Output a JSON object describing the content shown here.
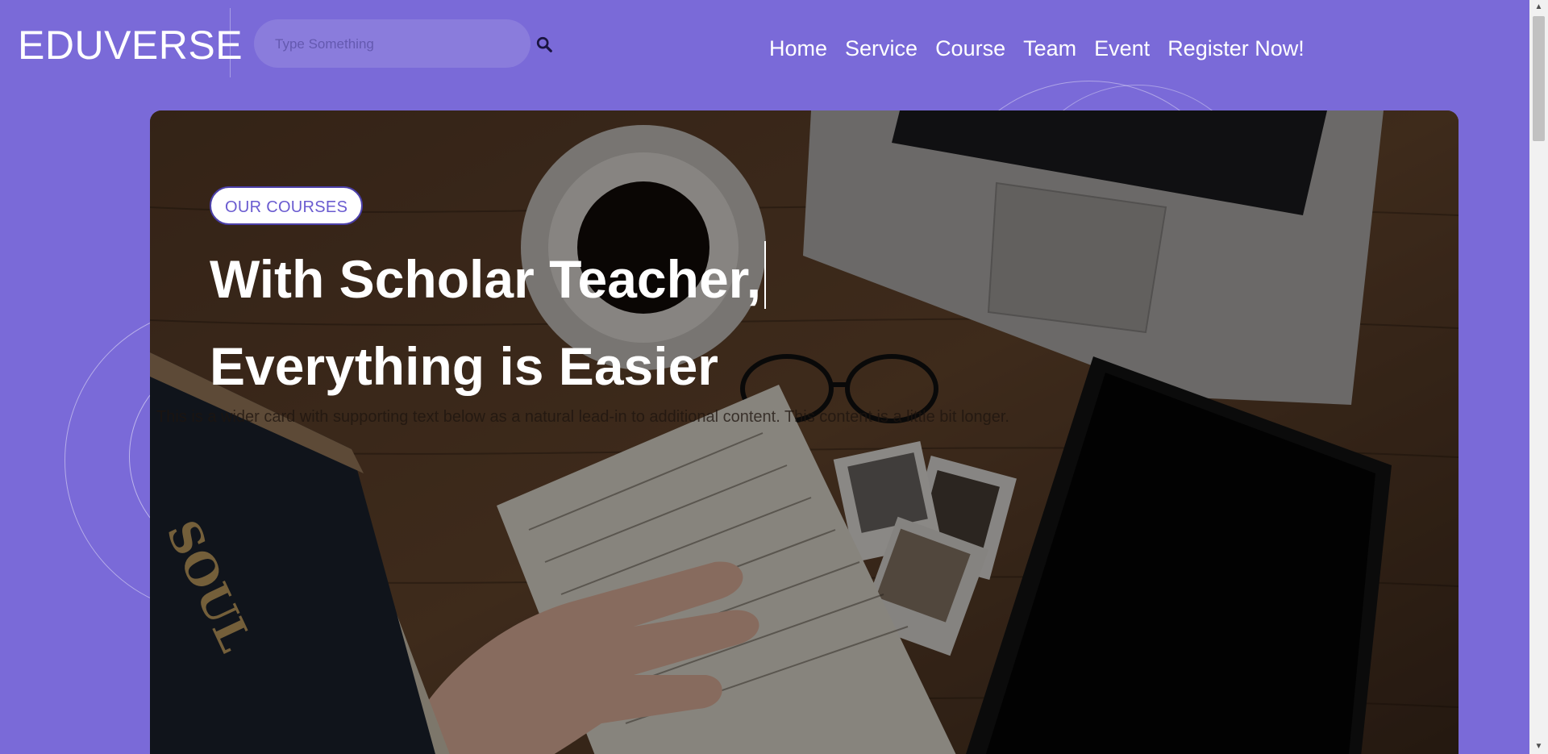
{
  "header": {
    "logo": "EDUVERSE",
    "search": {
      "placeholder": "Type Something",
      "value": ""
    },
    "nav": [
      {
        "label": "Home"
      },
      {
        "label": "Service"
      },
      {
        "label": "Course"
      },
      {
        "label": "Team"
      },
      {
        "label": "Event"
      },
      {
        "label": "Register Now!"
      }
    ]
  },
  "hero": {
    "badge": "OUR COURSES",
    "headline_line1": "With Scholar Teacher,",
    "headline_line2": "Everything is Easier",
    "description": "This is a wider card with supporting text below as a natural lead-in to additional content. This content is a little bit longer."
  },
  "colors": {
    "background": "#7a6ad8",
    "badge_text": "#6a5bd0",
    "text": "#ffffff"
  },
  "icons": {
    "search": "search-icon"
  }
}
